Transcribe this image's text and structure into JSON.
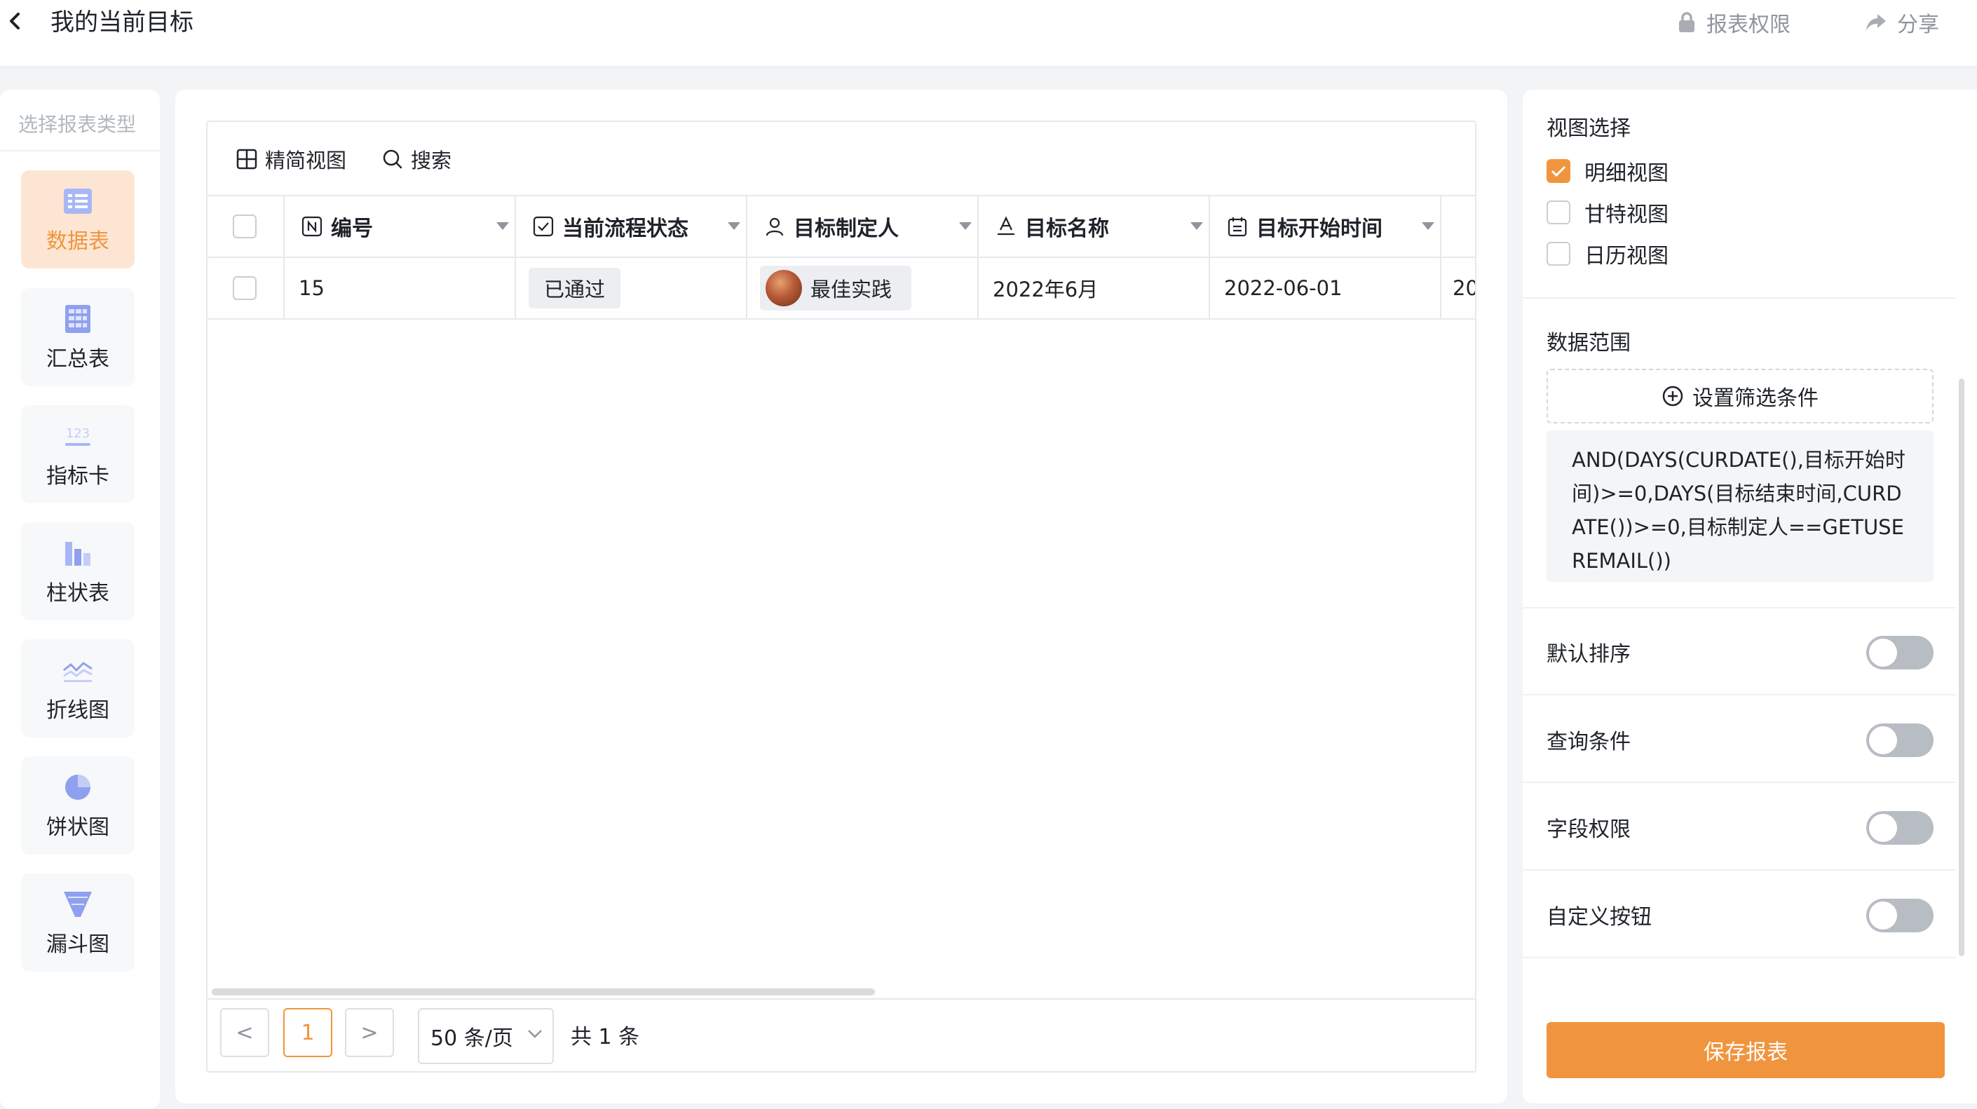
{
  "header": {
    "title": "我的当前目标",
    "report_permission": "报表权限",
    "share": "分享"
  },
  "sidebar": {
    "title": "选择报表类型",
    "items": [
      {
        "label": "数据表",
        "icon": "table-icon",
        "active": true
      },
      {
        "label": "汇总表",
        "icon": "summary-table-icon"
      },
      {
        "label": "指标卡",
        "icon": "metric-card-icon"
      },
      {
        "label": "柱状表",
        "icon": "bar-chart-icon"
      },
      {
        "label": "折线图",
        "icon": "line-chart-icon"
      },
      {
        "label": "饼状图",
        "icon": "pie-chart-icon"
      },
      {
        "label": "漏斗图",
        "icon": "funnel-chart-icon"
      }
    ]
  },
  "toolbar": {
    "simple_view": "精简视图",
    "search": "搜索"
  },
  "table": {
    "columns": [
      {
        "label": "编号",
        "icon": "number-field-icon"
      },
      {
        "label": "当前流程状态",
        "icon": "checkbox-field-icon"
      },
      {
        "label": "目标制定人",
        "icon": "person-field-icon"
      },
      {
        "label": "目标名称",
        "icon": "text-field-icon"
      },
      {
        "label": "目标开始时间",
        "icon": "date-field-icon"
      }
    ],
    "rows": [
      {
        "id": "15",
        "status": "已通过",
        "owner": "最佳实践",
        "name": "2022年6月",
        "start": "2022-06-01",
        "next_partial": "20"
      }
    ]
  },
  "pagination": {
    "prev": "<",
    "current_page": "1",
    "next": ">",
    "page_size": "50 条/页",
    "total": "共 1 条"
  },
  "right_panel": {
    "view_title": "视图选择",
    "views": [
      {
        "label": "明细视图",
        "checked": true
      },
      {
        "label": "甘特视图",
        "checked": false
      },
      {
        "label": "日历视图",
        "checked": false
      }
    ],
    "data_range_title": "数据范围",
    "filter_button": "设置筛选条件",
    "formula": "AND(DAYS(CURDATE(),目标开始时间)>=0,DAYS(目标结束时间,CURDATE())>=0,目标制定人==GETUSEREMAIL())",
    "toggles": [
      {
        "label": "默认排序",
        "on": false
      },
      {
        "label": "查询条件",
        "on": false
      },
      {
        "label": "字段权限",
        "on": false
      },
      {
        "label": "自定义按钮",
        "on": false
      }
    ],
    "save_button": "保存报表"
  },
  "colors": {
    "accent": "#f0953e",
    "active_bg": "#fce6d3",
    "toggle_off": "#b8bcc3"
  }
}
